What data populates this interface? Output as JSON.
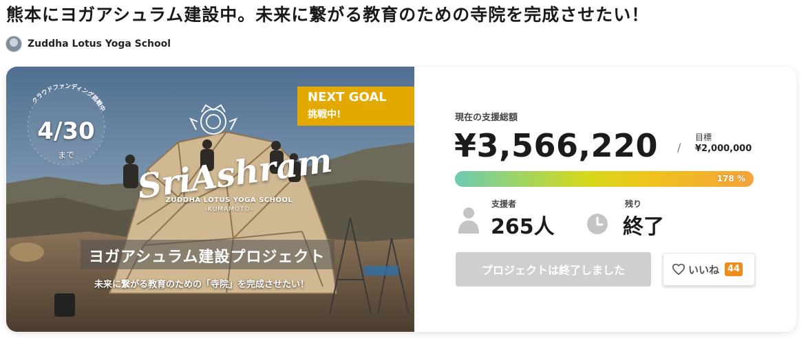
{
  "project": {
    "title": "熊本にヨガアシュラム建設中。未来に繋がる教育のための寺院を完成させたい！",
    "owner_name": "Zuddha Lotus Yoga School"
  },
  "hero": {
    "ring_text": "クラウドファンディング挑戦中",
    "deadline_date": "4/30",
    "deadline_suffix": "まで",
    "next_goal_en": "NEXT GOAL",
    "next_goal_jp": "挑戦中!",
    "logo_script": "SriAshram",
    "logo_sub": "ZUDDHA LOTUS YOGA SCHOOL",
    "logo_city": "-KUMAMOTO-",
    "banner_title": "ヨガアシュラム建設プロジェクト",
    "banner_subtitle": "未来に繋がる教育のための「寺院」を完成させたい！"
  },
  "stats": {
    "total_label": "現在の支援総額",
    "total_amount": "¥3,566,220",
    "slash": "/",
    "goal_label": "目標",
    "goal_amount": "¥2,000,000",
    "progress_text": "178 %",
    "progress_percent": 178,
    "backers_label": "支援者",
    "backers_count": "265人",
    "remaining_label": "残り",
    "remaining_value": "終了"
  },
  "actions": {
    "ended_label": "プロジェクトは終了しました",
    "like_label": "いいね",
    "like_count": "44"
  },
  "colors": {
    "next_goal_bg": "#e3a900",
    "like_badge": "#f08c1a",
    "ended_button_bg": "#cfcfcf",
    "progress_gradient": [
      "#6ccbb3",
      "#a7d55a",
      "#d7d81a",
      "#efc31d",
      "#f5a339"
    ]
  },
  "icons": {
    "backers": "person-icon",
    "remaining": "clock-icon",
    "like": "heart-icon"
  }
}
